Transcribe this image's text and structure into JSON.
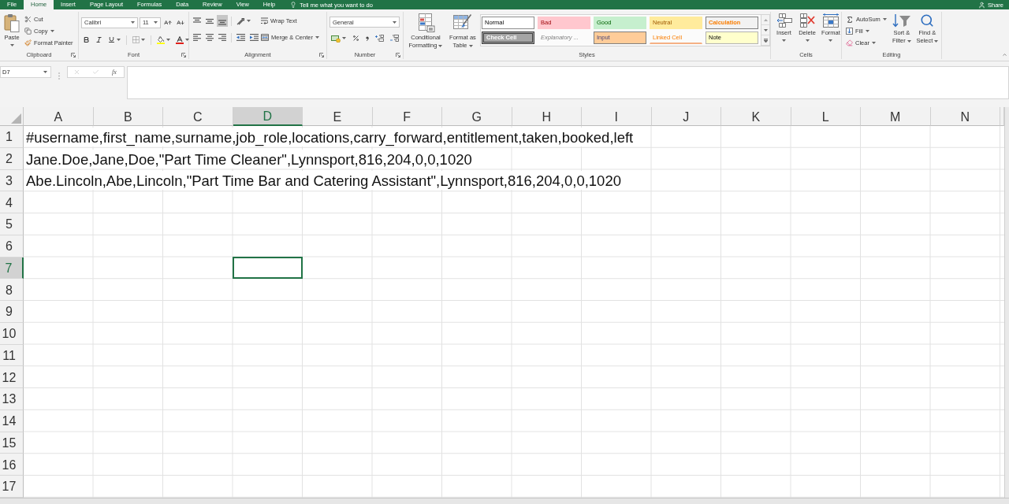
{
  "ribbon_tabs": [
    {
      "label": "File",
      "selected": false
    },
    {
      "label": "Home",
      "selected": true
    },
    {
      "label": "Insert",
      "selected": false
    },
    {
      "label": "Page Layout",
      "selected": false
    },
    {
      "label": "Formulas",
      "selected": false
    },
    {
      "label": "Data",
      "selected": false
    },
    {
      "label": "Review",
      "selected": false
    },
    {
      "label": "View",
      "selected": false
    },
    {
      "label": "Help",
      "selected": false
    }
  ],
  "tell_me": {
    "placeholder": "Tell me what you want to do"
  },
  "share": "Share",
  "clipboard": {
    "label": "Clipboard",
    "paste": "Paste",
    "cut": "Cut",
    "copy": "Copy",
    "format_painter": "Format Painter"
  },
  "font": {
    "label": "Font",
    "name": "Calibri",
    "size": "11"
  },
  "alignment": {
    "label": "Alignment",
    "vertical": [
      {
        "kind": "top",
        "selected": false
      },
      {
        "kind": "middle",
        "selected": false
      },
      {
        "kind": "bottom",
        "selected": true
      }
    ],
    "wrap_text": "Wrap Text",
    "merge": "Merge & Center"
  },
  "number": {
    "label": "Number",
    "format": "General"
  },
  "styles": {
    "label": "Styles",
    "conditional_formatting": "Conditional Formatting",
    "format_as_table": "Format as Table",
    "cell_styles": [
      {
        "label": "Normal",
        "kind": "normal"
      },
      {
        "label": "Bad",
        "kind": "bad"
      },
      {
        "label": "Good",
        "kind": "good"
      },
      {
        "label": "Neutral",
        "kind": "neutral"
      },
      {
        "label": "Calculation",
        "kind": "calculation"
      },
      {
        "label": "Check Cell",
        "kind": "check"
      },
      {
        "label": "Explanatory ...",
        "kind": "explanatory"
      },
      {
        "label": "Input",
        "kind": "input"
      },
      {
        "label": "Linked Cell",
        "kind": "linked"
      },
      {
        "label": "Note",
        "kind": "note"
      }
    ]
  },
  "cells": {
    "label": "Cells",
    "insert": "Insert",
    "delete": "Delete",
    "format": "Format"
  },
  "editing": {
    "label": "Editing",
    "autosum": "AutoSum",
    "fill": "Fill",
    "clear": "Clear",
    "sort_filter": "Sort & Filter",
    "find_select": "Find & Select"
  },
  "formula_bar": {
    "name_box": "D7",
    "function_label": "fx"
  },
  "sheet": {
    "columns": [
      {
        "label": "A",
        "selected": false
      },
      {
        "label": "B",
        "selected": false
      },
      {
        "label": "C",
        "selected": false
      },
      {
        "label": "D",
        "selected": true
      },
      {
        "label": "E",
        "selected": false
      },
      {
        "label": "F",
        "selected": false
      },
      {
        "label": "G",
        "selected": false
      },
      {
        "label": "H",
        "selected": false
      },
      {
        "label": "I",
        "selected": false
      },
      {
        "label": "J",
        "selected": false
      },
      {
        "label": "K",
        "selected": false
      },
      {
        "label": "L",
        "selected": false
      },
      {
        "label": "M",
        "selected": false
      },
      {
        "label": "N",
        "selected": false
      }
    ],
    "rows": [
      {
        "header": "1",
        "selected": false,
        "text": "#username,first_name,surname,job_role,locations,carry_forward,entitlement,taken,booked,left"
      },
      {
        "header": "2",
        "selected": false,
        "text": "Jane.Doe,Jane,Doe,\"Part Time Cleaner\",Lynnsport,816,204,0,0,1020"
      },
      {
        "header": "3",
        "selected": false,
        "text": "Abe.Lincoln,Abe,Lincoln,\"Part Time Bar and Catering Assistant\",Lynnsport,816,204,0,0,1020"
      },
      {
        "header": "4",
        "selected": false
      },
      {
        "header": "5",
        "selected": false
      },
      {
        "header": "6",
        "selected": false
      },
      {
        "header": "7",
        "selected": true
      },
      {
        "header": "8",
        "selected": false
      },
      {
        "header": "9",
        "selected": false
      },
      {
        "header": "10",
        "selected": false
      },
      {
        "header": "11",
        "selected": false
      },
      {
        "header": "12",
        "selected": false
      },
      {
        "header": "13",
        "selected": false
      },
      {
        "header": "14",
        "selected": false
      },
      {
        "header": "15",
        "selected": false
      },
      {
        "header": "16",
        "selected": false
      },
      {
        "header": "17",
        "selected": false
      }
    ]
  }
}
